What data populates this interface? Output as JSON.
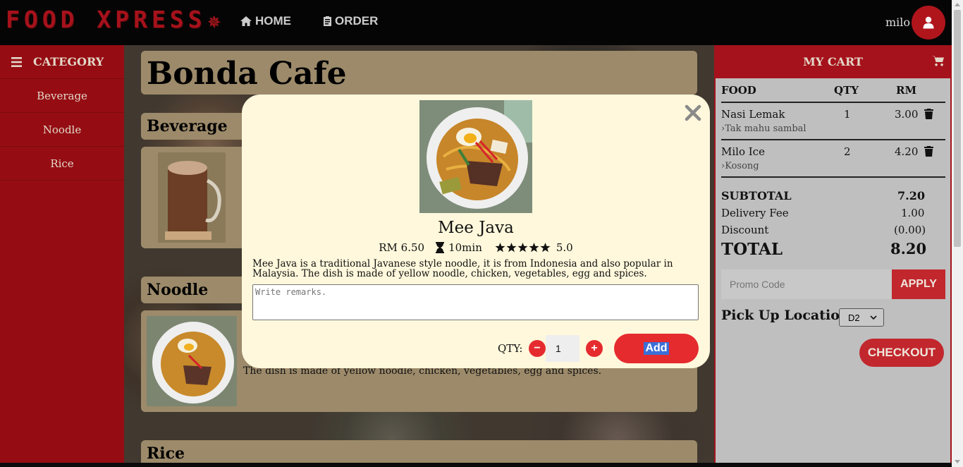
{
  "header": {
    "logo": "FOOD XPRESS",
    "nav": [
      {
        "label": "HOME",
        "icon": "home-icon"
      },
      {
        "label": "ORDER",
        "icon": "clipboard-icon"
      }
    ],
    "username": "milo"
  },
  "sidebar": {
    "title": "CATEGORY",
    "items": [
      {
        "label": "Beverage"
      },
      {
        "label": "Noodle"
      },
      {
        "label": "Rice"
      }
    ]
  },
  "main": {
    "restaurant": "Bonda Cafe",
    "sections": [
      {
        "title": "Beverage"
      },
      {
        "title": "Noodle"
      },
      {
        "title": "Rice"
      }
    ],
    "noodle_desc_visible": "The dish is made of yellow noodle, chicken, vegetables, egg and spices."
  },
  "modal": {
    "name": "Mee Java",
    "price": "RM 6.50",
    "time": "10min",
    "rating": "5.0",
    "stars": 5,
    "description": "Mee Java is a traditional Javanese style noodle, it is from Indonesia and also popular in Malaysia. The dish is made of yellow noodle, chicken, vegetables, egg and spices.",
    "remarks_placeholder": "Write remarks.",
    "qty_label": "QTY:",
    "qty": "1",
    "minus": "−",
    "plus": "+",
    "add_label": "Add"
  },
  "cart": {
    "title": "MY CART",
    "columns": [
      "FOOD",
      "QTY",
      "RM"
    ],
    "items": [
      {
        "name": "Nasi Lemak",
        "qty": "1",
        "price": "3.00",
        "remark": "Tak mahu sambal"
      },
      {
        "name": "Milo Ice",
        "qty": "2",
        "price": "4.20",
        "remark": "Kosong"
      }
    ],
    "subtotal_label": "SUBTOTAL",
    "subtotal": "7.20",
    "delivery_label": "Delivery Fee",
    "delivery": "1.00",
    "discount_label": "Discount",
    "discount": "(0.00)",
    "total_label": "TOTAL",
    "total": "8.20",
    "promo_placeholder": "Promo Code",
    "apply_label": "APPLY",
    "pickup_label": "Pick Up Location:",
    "pickup_value": "D2",
    "checkout_label": "CHECKOUT"
  },
  "colors": {
    "brand_red": "#a5121b",
    "button_red": "#e52b2e",
    "modal_bg": "#fff8dc",
    "sidebar": "#950d13"
  }
}
